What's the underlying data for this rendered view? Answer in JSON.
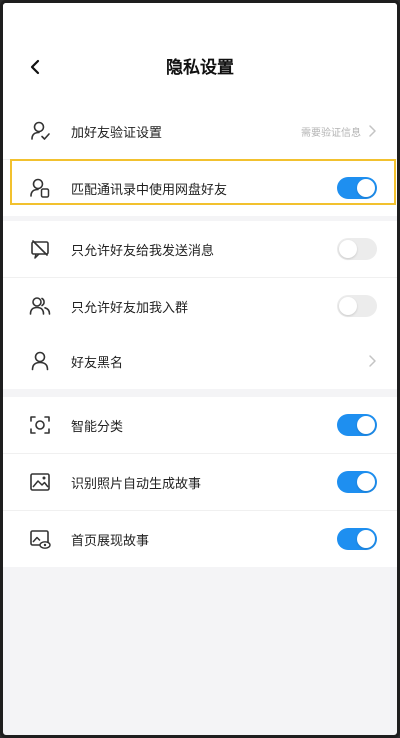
{
  "header": {
    "title": "隐私设置"
  },
  "section1": [
    {
      "label": "加好友验证设置",
      "value": "需要验证信息",
      "icon": "user-check-icon",
      "type": "chevron"
    },
    {
      "label": "匹配通讯录中使用网盘好友",
      "icon": "contacts-match-icon",
      "type": "toggle",
      "on": true
    }
  ],
  "section2": [
    {
      "label": "只允许好友给我发送消息",
      "icon": "message-block-icon",
      "type": "toggle",
      "on": false
    },
    {
      "label": "只允许好友加我入群",
      "icon": "group-icon",
      "type": "toggle",
      "on": false
    }
  ],
  "section3": [
    {
      "label": "好友黑名",
      "icon": "user-icon",
      "type": "chevron"
    }
  ],
  "section4": [
    {
      "label": "智能分类",
      "icon": "scan-face-icon",
      "type": "toggle",
      "on": true
    },
    {
      "label": "识别照片自动生成故事",
      "icon": "photo-icon",
      "type": "toggle",
      "on": true
    },
    {
      "label": "首页展现故事",
      "icon": "photo-eye-icon",
      "type": "toggle",
      "on": true
    }
  ],
  "colors": {
    "accent": "#1e8ff0",
    "highlight": "#f2c12e"
  }
}
